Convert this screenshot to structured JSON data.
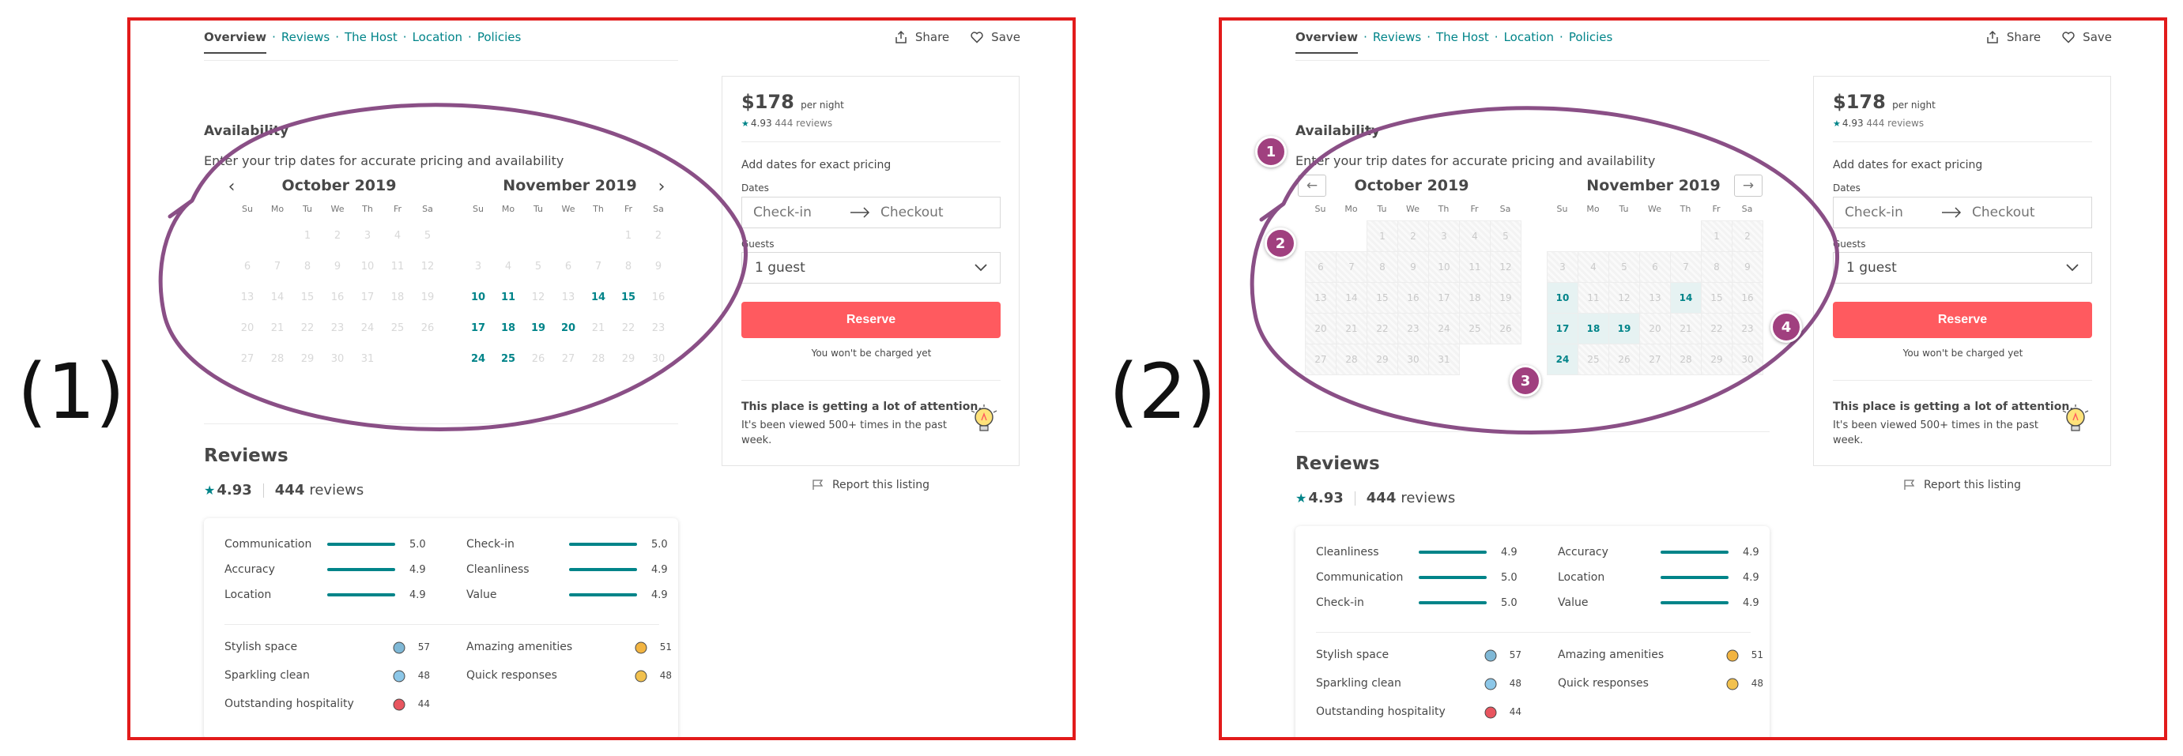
{
  "panels": [
    {
      "label": "(1)"
    },
    {
      "label": "(2)"
    }
  ],
  "nav": {
    "overview": "Overview",
    "reviews": "Reviews",
    "host": "The Host",
    "location": "Location",
    "policies": "Policies",
    "sep": "·",
    "share": "Share",
    "save": "Save"
  },
  "availability": {
    "title": "Availability",
    "subtitle": "Enter your trip dates for accurate pricing and availability",
    "prev_label": "‹",
    "next_label": "›",
    "prev_arrow": "←",
    "next_arrow": "→",
    "weekdays": [
      "Su",
      "Mo",
      "Tu",
      "We",
      "Th",
      "Fr",
      "Sa"
    ],
    "months": [
      {
        "title": "October 2019",
        "leading_blanks": 2,
        "days": 31,
        "available": []
      },
      {
        "title": "November 2019",
        "leading_blanks": 5,
        "days": 30,
        "available": [
          10,
          11,
          14,
          15,
          17,
          18,
          19,
          20,
          24,
          25
        ]
      }
    ],
    "months_panel2": [
      {
        "title": "October 2019",
        "leading_blanks": 2,
        "days": 31,
        "available": []
      },
      {
        "title": "November 2019",
        "leading_blanks": 5,
        "days": 30,
        "available": [
          10,
          14,
          17,
          18,
          19,
          24
        ]
      }
    ]
  },
  "reviews": {
    "title": "Reviews",
    "score": "4.93",
    "count": "444",
    "count_label": "reviews",
    "ratings_panel1": [
      {
        "label": "Communication",
        "value": "5.0"
      },
      {
        "label": "Check-in",
        "value": "5.0"
      },
      {
        "label": "Accuracy",
        "value": "4.9"
      },
      {
        "label": "Cleanliness",
        "value": "4.9"
      },
      {
        "label": "Location",
        "value": "4.9"
      },
      {
        "label": "Value",
        "value": "4.9"
      }
    ],
    "ratings_panel2": [
      {
        "label": "Cleanliness",
        "value": "4.9"
      },
      {
        "label": "Accuracy",
        "value": "4.9"
      },
      {
        "label": "Communication",
        "value": "5.0"
      },
      {
        "label": "Location",
        "value": "4.9"
      },
      {
        "label": "Check-in",
        "value": "5.0"
      },
      {
        "label": "Value",
        "value": "4.9"
      }
    ],
    "highlights": [
      {
        "label": "Stylish space",
        "count": "57",
        "icon": "stylish-space-icon"
      },
      {
        "label": "Amazing amenities",
        "count": "51",
        "icon": "amenities-icon"
      },
      {
        "label": "Sparkling clean",
        "count": "48",
        "icon": "sparkling-clean-icon"
      },
      {
        "label": "Quick responses",
        "count": "48",
        "icon": "quick-responses-icon"
      },
      {
        "label": "Outstanding hospitality",
        "count": "44",
        "icon": "hospitality-icon"
      }
    ]
  },
  "booking": {
    "price": "$178",
    "per_night": "per night",
    "rating_score": "4.93",
    "rating_count": "444 reviews",
    "add_dates": "Add dates for exact pricing",
    "dates_label": "Dates",
    "checkin_placeholder": "Check-in",
    "checkout_placeholder": "Checkout",
    "guests_label": "Guests",
    "guests_value": "1 guest",
    "reserve_label": "Reserve",
    "not_charged": "You won't be charged yet",
    "attention_title": "This place is getting a lot of attention.",
    "attention_text": "It's been viewed 500+ times in the past week.",
    "report_label": "Report this listing"
  },
  "markers": [
    "1",
    "2",
    "3",
    "4"
  ],
  "colors": {
    "teal": "#008489",
    "reserve": "#ff5a5f",
    "annotation": "#a0407f",
    "frame": "#e21b1b"
  }
}
